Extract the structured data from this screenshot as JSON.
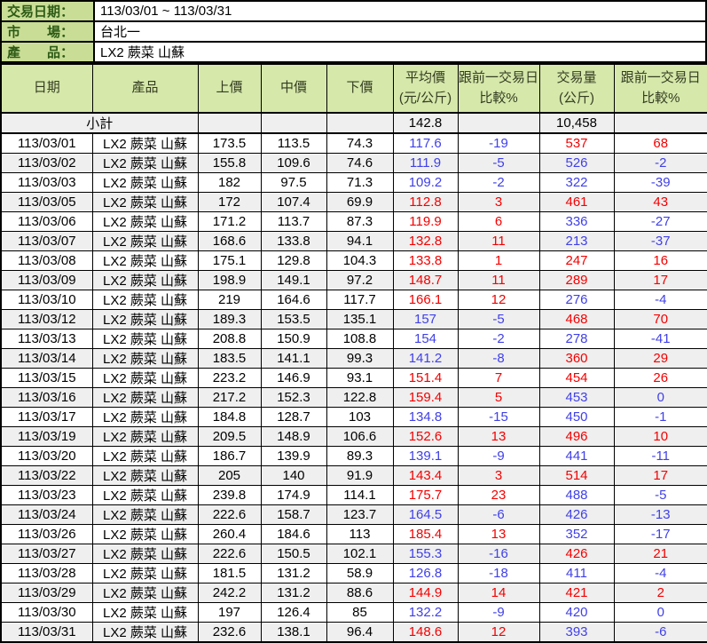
{
  "info": {
    "rows": [
      {
        "label": "交易日期：",
        "value": "113/03/01 ~ 113/03/31"
      },
      {
        "label": "市　　場：",
        "value": "台北一"
      },
      {
        "label": "產　　品：",
        "value": "LX2 蕨菜 山蘇"
      }
    ]
  },
  "table": {
    "headers": [
      {
        "id": "date",
        "lines": [
          "日期"
        ]
      },
      {
        "id": "product",
        "lines": [
          "產品"
        ]
      },
      {
        "id": "high",
        "lines": [
          "上價"
        ]
      },
      {
        "id": "mid",
        "lines": [
          "中價"
        ]
      },
      {
        "id": "low",
        "lines": [
          "下價"
        ]
      },
      {
        "id": "avg",
        "lines": [
          "平均價",
          "(元/公斤)"
        ]
      },
      {
        "id": "avg-change",
        "lines": [
          "跟前一交易日",
          "比較%"
        ]
      },
      {
        "id": "volume",
        "lines": [
          "交易量",
          "(公斤)"
        ]
      },
      {
        "id": "vol-change",
        "lines": [
          "跟前一交易日",
          "比較%"
        ]
      }
    ],
    "subtotal": {
      "label": "小計",
      "avg_price": "142.8",
      "volume": "10,458"
    },
    "rows": [
      {
        "date": "113/03/01",
        "product": "LX2 蕨菜 山蘇",
        "high": "173.5",
        "mid": "113.5",
        "low": "74.3",
        "avg": "117.6",
        "avg_chg": "-19",
        "vol": "537",
        "vol_chg": "68"
      },
      {
        "date": "113/03/02",
        "product": "LX2 蕨菜 山蘇",
        "high": "155.8",
        "mid": "109.6",
        "low": "74.6",
        "avg": "111.9",
        "avg_chg": "-5",
        "vol": "526",
        "vol_chg": "-2"
      },
      {
        "date": "113/03/03",
        "product": "LX2 蕨菜 山蘇",
        "high": "182",
        "mid": "97.5",
        "low": "71.3",
        "avg": "109.2",
        "avg_chg": "-2",
        "vol": "322",
        "vol_chg": "-39"
      },
      {
        "date": "113/03/05",
        "product": "LX2 蕨菜 山蘇",
        "high": "172",
        "mid": "107.4",
        "low": "69.9",
        "avg": "112.8",
        "avg_chg": "3",
        "vol": "461",
        "vol_chg": "43"
      },
      {
        "date": "113/03/06",
        "product": "LX2 蕨菜 山蘇",
        "high": "171.2",
        "mid": "113.7",
        "low": "87.3",
        "avg": "119.9",
        "avg_chg": "6",
        "vol": "336",
        "vol_chg": "-27"
      },
      {
        "date": "113/03/07",
        "product": "LX2 蕨菜 山蘇",
        "high": "168.6",
        "mid": "133.8",
        "low": "94.1",
        "avg": "132.8",
        "avg_chg": "11",
        "vol": "213",
        "vol_chg": "-37"
      },
      {
        "date": "113/03/08",
        "product": "LX2 蕨菜 山蘇",
        "high": "175.1",
        "mid": "129.8",
        "low": "104.3",
        "avg": "133.8",
        "avg_chg": "1",
        "vol": "247",
        "vol_chg": "16"
      },
      {
        "date": "113/03/09",
        "product": "LX2 蕨菜 山蘇",
        "high": "198.9",
        "mid": "149.1",
        "low": "97.2",
        "avg": "148.7",
        "avg_chg": "11",
        "vol": "289",
        "vol_chg": "17"
      },
      {
        "date": "113/03/10",
        "product": "LX2 蕨菜 山蘇",
        "high": "219",
        "mid": "164.6",
        "low": "117.7",
        "avg": "166.1",
        "avg_chg": "12",
        "vol": "276",
        "vol_chg": "-4"
      },
      {
        "date": "113/03/12",
        "product": "LX2 蕨菜 山蘇",
        "high": "189.3",
        "mid": "153.5",
        "low": "135.1",
        "avg": "157",
        "avg_chg": "-5",
        "vol": "468",
        "vol_chg": "70"
      },
      {
        "date": "113/03/13",
        "product": "LX2 蕨菜 山蘇",
        "high": "208.8",
        "mid": "150.9",
        "low": "108.8",
        "avg": "154",
        "avg_chg": "-2",
        "vol": "278",
        "vol_chg": "-41"
      },
      {
        "date": "113/03/14",
        "product": "LX2 蕨菜 山蘇",
        "high": "183.5",
        "mid": "141.1",
        "low": "99.3",
        "avg": "141.2",
        "avg_chg": "-8",
        "vol": "360",
        "vol_chg": "29"
      },
      {
        "date": "113/03/15",
        "product": "LX2 蕨菜 山蘇",
        "high": "223.2",
        "mid": "146.9",
        "low": "93.1",
        "avg": "151.4",
        "avg_chg": "7",
        "vol": "454",
        "vol_chg": "26"
      },
      {
        "date": "113/03/16",
        "product": "LX2 蕨菜 山蘇",
        "high": "217.2",
        "mid": "152.3",
        "low": "122.8",
        "avg": "159.4",
        "avg_chg": "5",
        "vol": "453",
        "vol_chg": "0"
      },
      {
        "date": "113/03/17",
        "product": "LX2 蕨菜 山蘇",
        "high": "184.8",
        "mid": "128.7",
        "low": "103",
        "avg": "134.8",
        "avg_chg": "-15",
        "vol": "450",
        "vol_chg": "-1"
      },
      {
        "date": "113/03/19",
        "product": "LX2 蕨菜 山蘇",
        "high": "209.5",
        "mid": "148.9",
        "low": "106.6",
        "avg": "152.6",
        "avg_chg": "13",
        "vol": "496",
        "vol_chg": "10"
      },
      {
        "date": "113/03/20",
        "product": "LX2 蕨菜 山蘇",
        "high": "186.7",
        "mid": "139.9",
        "low": "89.3",
        "avg": "139.1",
        "avg_chg": "-9",
        "vol": "441",
        "vol_chg": "-11"
      },
      {
        "date": "113/03/22",
        "product": "LX2 蕨菜 山蘇",
        "high": "205",
        "mid": "140",
        "low": "91.9",
        "avg": "143.4",
        "avg_chg": "3",
        "vol": "514",
        "vol_chg": "17"
      },
      {
        "date": "113/03/23",
        "product": "LX2 蕨菜 山蘇",
        "high": "239.8",
        "mid": "174.9",
        "low": "114.1",
        "avg": "175.7",
        "avg_chg": "23",
        "vol": "488",
        "vol_chg": "-5"
      },
      {
        "date": "113/03/24",
        "product": "LX2 蕨菜 山蘇",
        "high": "222.6",
        "mid": "158.7",
        "low": "123.7",
        "avg": "164.5",
        "avg_chg": "-6",
        "vol": "426",
        "vol_chg": "-13"
      },
      {
        "date": "113/03/26",
        "product": "LX2 蕨菜 山蘇",
        "high": "260.4",
        "mid": "184.6",
        "low": "113",
        "avg": "185.4",
        "avg_chg": "13",
        "vol": "352",
        "vol_chg": "-17"
      },
      {
        "date": "113/03/27",
        "product": "LX2 蕨菜 山蘇",
        "high": "222.6",
        "mid": "150.5",
        "low": "102.1",
        "avg": "155.3",
        "avg_chg": "-16",
        "vol": "426",
        "vol_chg": "21"
      },
      {
        "date": "113/03/28",
        "product": "LX2 蕨菜 山蘇",
        "high": "181.5",
        "mid": "131.2",
        "low": "58.9",
        "avg": "126.8",
        "avg_chg": "-18",
        "vol": "411",
        "vol_chg": "-4"
      },
      {
        "date": "113/03/29",
        "product": "LX2 蕨菜 山蘇",
        "high": "242.2",
        "mid": "131.2",
        "low": "88.6",
        "avg": "144.9",
        "avg_chg": "14",
        "vol": "421",
        "vol_chg": "2"
      },
      {
        "date": "113/03/30",
        "product": "LX2 蕨菜 山蘇",
        "high": "197",
        "mid": "126.4",
        "low": "85",
        "avg": "132.2",
        "avg_chg": "-9",
        "vol": "420",
        "vol_chg": "0"
      },
      {
        "date": "113/03/31",
        "product": "LX2 蕨菜 山蘇",
        "high": "232.6",
        "mid": "138.1",
        "low": "96.4",
        "avg": "148.6",
        "avg_chg": "12",
        "vol": "393",
        "vol_chg": "-6"
      }
    ]
  },
  "colors": {
    "up": "#f40000",
    "down": "#4040e8",
    "label_bg": "#c9dd96",
    "header_bg": "#d6e8aa",
    "label_text": "#2d5b16",
    "header_text": "#343d22",
    "stripe": "#efefef"
  }
}
